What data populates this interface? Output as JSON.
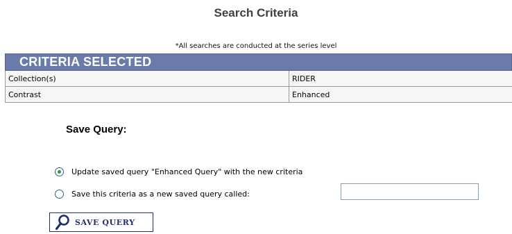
{
  "page": {
    "title": "Search Criteria",
    "note": "*All searches are conducted at the series level"
  },
  "criteria": {
    "header": "CRITERIA SELECTED",
    "rows": [
      {
        "name": "Collection(s)",
        "value": "RIDER"
      },
      {
        "name": "Contrast",
        "value": "Enhanced"
      }
    ]
  },
  "save_query": {
    "title": "Save Query:",
    "options": [
      {
        "label": "Update saved query \"Enhanced Query\" with the new criteria",
        "selected": true
      },
      {
        "label": "Save this criteria as a new saved query called:",
        "selected": false
      }
    ],
    "new_query_name": {
      "value": "",
      "placeholder": ""
    },
    "button_label": "SAVE QUERY",
    "button_icon": "magnifier-icon"
  },
  "colors": {
    "header_background": "#6b7ba9",
    "button_border": "#1e2f6e",
    "radio_selected_dot": "#1f9e2c"
  }
}
